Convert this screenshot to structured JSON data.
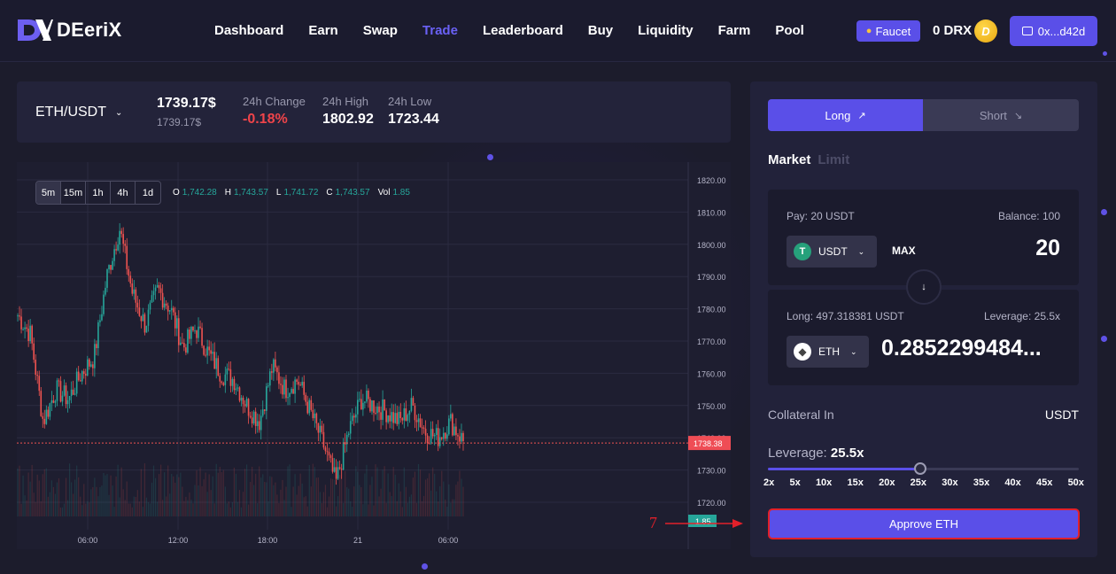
{
  "brand": {
    "name": "DEeriX"
  },
  "nav": {
    "links": [
      {
        "label": "Dashboard",
        "active": false
      },
      {
        "label": "Earn",
        "active": false
      },
      {
        "label": "Swap",
        "active": false
      },
      {
        "label": "Trade",
        "active": true
      },
      {
        "label": "Leaderboard",
        "active": false
      },
      {
        "label": "Buy",
        "active": false
      },
      {
        "label": "Liquidity",
        "active": false
      },
      {
        "label": "Farm",
        "active": false
      },
      {
        "label": "Pool",
        "active": false
      }
    ],
    "faucet_label": "Faucet",
    "drx_balance": "0 DRX",
    "drx_coin_glyph": "D",
    "wallet_label": "0x...d42d"
  },
  "ticker": {
    "pair": "ETH/USDT",
    "price": "1739.17$",
    "price_sub": "1739.17$",
    "change_label": "24h Change",
    "change_value": "-0.18%",
    "high_label": "24h High",
    "high_value": "1802.92",
    "low_label": "24h Low",
    "low_value": "1723.44"
  },
  "chart": {
    "timeframes": [
      "5m",
      "15m",
      "1h",
      "4h",
      "1d"
    ],
    "active_timeframe": "5m",
    "ohlc": {
      "o_label": "O",
      "o": "1,742.28",
      "h_label": "H",
      "h": "1,743.57",
      "l_label": "L",
      "l": "1,741.72",
      "c_label": "C",
      "c": "1,743.57",
      "vol_label": "Vol",
      "vol": "1.85"
    },
    "colors": {
      "up": "#26a69a",
      "down": "#ef5350",
      "grid": "#2b2b40"
    },
    "y_ticks": [
      "1820.00",
      "1810.00",
      "1800.00",
      "1790.00",
      "1780.00",
      "1770.00",
      "1760.00",
      "1750.00",
      "1740.00",
      "1730.00",
      "1720.00"
    ],
    "x_ticks": [
      "06:00",
      "12:00",
      "18:00",
      "21",
      "06:00"
    ],
    "current_price_label": "1738.38",
    "volume_label": "1.85"
  },
  "chart_data": {
    "type": "candlestick",
    "x_ticks": [
      "06:00",
      "12:00",
      "18:00",
      "21",
      "06:00"
    ],
    "ylim": [
      1715,
      1824
    ],
    "last_price": 1738.38,
    "current_open": 1742.28,
    "current_high": 1743.57,
    "current_low": 1741.72,
    "current_close": 1743.57,
    "current_volume": 1.85,
    "trend_closes": [
      1778,
      1772,
      1745,
      1755,
      1752,
      1760,
      1765,
      1790,
      1805,
      1785,
      1775,
      1786,
      1780,
      1768,
      1774,
      1766,
      1760,
      1758,
      1750,
      1745,
      1762,
      1755,
      1758,
      1748,
      1738,
      1726,
      1742,
      1752,
      1750,
      1748,
      1745,
      1750,
      1742,
      1740,
      1745,
      1739
    ]
  },
  "trade": {
    "long_label": "Long",
    "long_icon": "↗",
    "short_label": "Short",
    "short_icon": "↘",
    "order_types": [
      "Market",
      "Limit"
    ],
    "pay_label": "Pay: 20 USDT",
    "balance_label": "Balance: 100",
    "pay_token": "USDT",
    "pay_token_glyph": "T",
    "max_label": "MAX",
    "pay_amount": "20",
    "swap_icon": "↓",
    "long_amount_label": "Long: 497.318381 USDT",
    "leverage_info": "Leverage: 25.5x",
    "long_token": "ETH",
    "long_token_glyph": "◆",
    "long_amount": "0.2852299484...",
    "collateral_label": "Collateral In",
    "collateral_value": "USDT",
    "leverage_label": "Leverage:",
    "leverage_value": "25.5x",
    "leverage_fraction": 0.49,
    "leverage_marks": [
      "2x",
      "5x",
      "10x",
      "15x",
      "20x",
      "25x",
      "30x",
      "35x",
      "40x",
      "45x",
      "50x"
    ],
    "approve_label": "Approve ETH"
  },
  "annotation": {
    "step": "7"
  }
}
